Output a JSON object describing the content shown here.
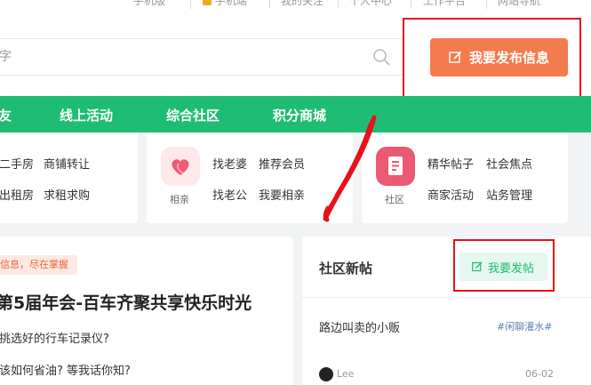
{
  "topbar": {
    "items": [
      "手机版",
      "手机端",
      "我的关注",
      "个人中心",
      "工作平台",
      "网站导航"
    ]
  },
  "search": {
    "placeholder": "字",
    "icon": "search-icon"
  },
  "post_button": {
    "label": "我要发布信息",
    "icon": "edit-icon",
    "color": "#f47b4e"
  },
  "nav": {
    "color": "#1fbd73",
    "items": [
      "友",
      "线上活动",
      "综合社区",
      "积分商城"
    ]
  },
  "categories": {
    "house": {
      "links": [
        "二手房",
        "商铺转让",
        "出租房",
        "求租求购"
      ]
    },
    "dating": {
      "label": "相亲",
      "icon": "heart-icon",
      "links": [
        "找老婆",
        "推荐会员",
        "找老公",
        "我要相亲"
      ]
    },
    "community": {
      "label": "社区",
      "icon": "document-icon",
      "links": [
        "精华帖子",
        "社会焦点",
        "商家活动",
        "站务管理"
      ]
    }
  },
  "news": {
    "tag": "信息，尽在掌握",
    "headline": "第5届年会-百车齐聚共享快乐时光",
    "items": [
      "挑选好的行车记录仪?",
      "该如何省油? 等我话你知?"
    ]
  },
  "new_posts": {
    "title": "社区新帖",
    "button": "我要发帖",
    "button_icon": "edit-icon",
    "posts": [
      {
        "title": "路边叫卖的小贩",
        "tag": "#闲聊灌水#",
        "author": "Lee",
        "date": "06-02"
      }
    ]
  },
  "colors": {
    "accent_green": "#1fbd73",
    "accent_orange": "#f47b4e",
    "annotation_red": "#e8101a"
  }
}
